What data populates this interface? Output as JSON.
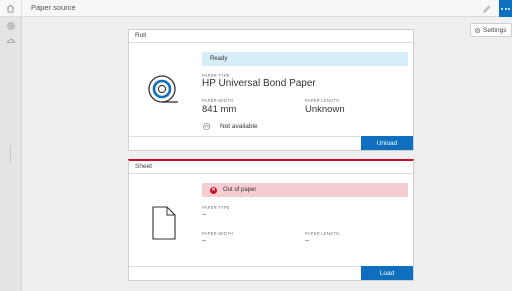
{
  "header": {
    "title": "Paper source"
  },
  "toolbar": {
    "settings_label": "Settings"
  },
  "roll": {
    "title": "Roll",
    "status": "Ready",
    "paper_type_label": "PAPER TYPE",
    "paper_type": "HP Universal Bond Paper",
    "paper_width_label": "PAPER WIDTH",
    "paper_width": "841 mm",
    "paper_length_label": "PAPER LENGTH",
    "paper_length": "Unknown",
    "availability": "Not available",
    "action_label": "Unload"
  },
  "sheet": {
    "title": "Sheet",
    "status": "Out of paper",
    "paper_type_label": "PAPER TYPE",
    "paper_type": "--",
    "paper_width_label": "PAPER WIDTH",
    "paper_width": "--",
    "paper_length_label": "PAPER LENGTH",
    "paper_length": "--",
    "action_label": "Load"
  },
  "colors": {
    "accent": "#0d6fbd",
    "ready_bg": "#d6eef7",
    "error_bg": "#f6cdd1",
    "error": "#c8102e"
  },
  "icons": [
    "home-icon",
    "pen-icon",
    "more-icon",
    "gear-icon",
    "clouds-icon",
    "roll-icon",
    "sheet-icon",
    "error-icon"
  ]
}
